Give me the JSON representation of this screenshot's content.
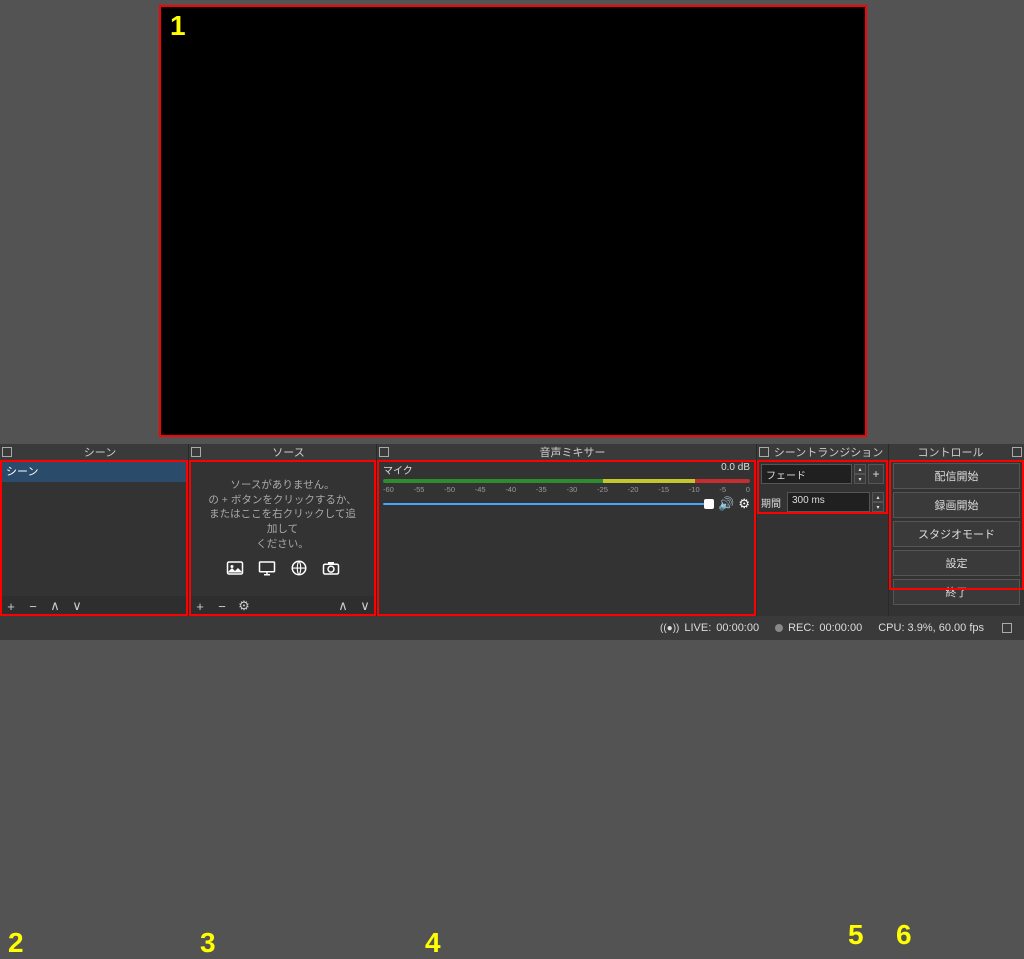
{
  "annotations": [
    "1",
    "2",
    "3",
    "4",
    "5",
    "6"
  ],
  "panels": {
    "scenes": {
      "title": "シーン",
      "items": [
        "シーン"
      ]
    },
    "sources": {
      "title": "ソース",
      "empty_l1": "ソースがありません。",
      "empty_l2": "の + ボタンをクリックするか、",
      "empty_l3": "またはここを右クリックして追加して",
      "empty_l4": "ください。"
    },
    "mixer": {
      "title": "音声ミキサー",
      "channel_name": "マイク",
      "db": "0.0 dB",
      "ticks": [
        "-60",
        "-55",
        "-50",
        "-45",
        "-40",
        "-35",
        "-30",
        "-25",
        "-20",
        "-15",
        "-10",
        "-5",
        "0"
      ]
    },
    "transitions": {
      "title": "シーントランジション",
      "type": "フェード",
      "duration_label": "期間",
      "duration_value": "300 ms"
    },
    "controls": {
      "title": "コントロール",
      "buttons": [
        "配信開始",
        "録画開始",
        "スタジオモード",
        "設定",
        "終了"
      ]
    }
  },
  "status": {
    "live_label": "LIVE:",
    "live_time": "00:00:00",
    "rec_label": "REC:",
    "rec_time": "00:00:00",
    "cpu": "CPU: 3.9%, 60.00 fps"
  }
}
